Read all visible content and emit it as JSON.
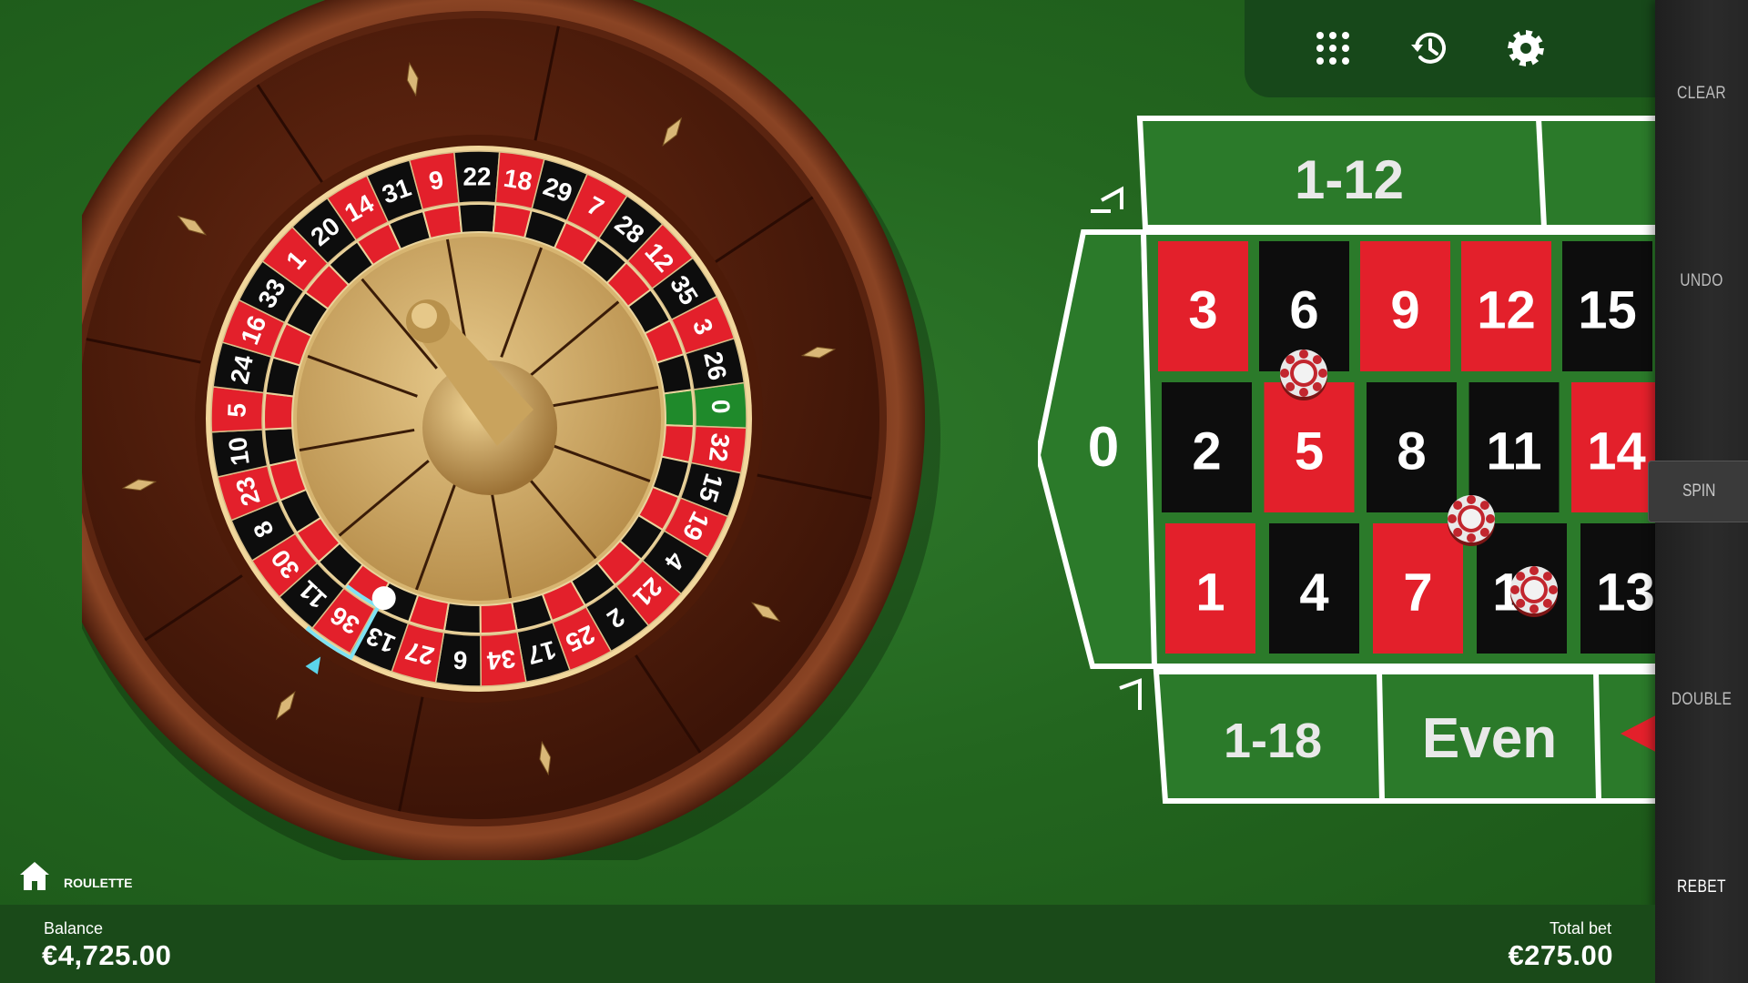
{
  "game": {
    "name": "ROULETTE"
  },
  "toolbar": {
    "icons": [
      "stats-dots-icon",
      "history-icon",
      "settings-gear-icon"
    ]
  },
  "sidebar": {
    "clear": "CLEAR",
    "undo": "UNDO",
    "spin": "SPIN",
    "double": "DOUBLE",
    "rebet": "REBET"
  },
  "balance": {
    "label": "Balance",
    "value": "€4,725.00"
  },
  "total_bet": {
    "label": "Total bet",
    "value": "€275.00"
  },
  "wheel": {
    "numbers": [
      0,
      32,
      15,
      19,
      4,
      21,
      2,
      25,
      17,
      34,
      6,
      27,
      13,
      36,
      11,
      30,
      8,
      23,
      10,
      5,
      24,
      16,
      33,
      1,
      20,
      14,
      31,
      9,
      22,
      18,
      29,
      7,
      28,
      12,
      35,
      3,
      26
    ],
    "red_numbers": [
      1,
      3,
      5,
      7,
      9,
      12,
      14,
      16,
      18,
      19,
      21,
      23,
      25,
      27,
      30,
      32,
      34,
      36
    ],
    "highlighted_number": 36
  },
  "table": {
    "zero": "0",
    "dozen": "1-12",
    "low": "1-18",
    "even": "Even",
    "rows": [
      [
        {
          "n": "3",
          "c": "red"
        },
        {
          "n": "6",
          "c": "black"
        },
        {
          "n": "9",
          "c": "red"
        },
        {
          "n": "12",
          "c": "red"
        },
        {
          "n": "15",
          "c": "black"
        }
      ],
      [
        {
          "n": "2",
          "c": "black"
        },
        {
          "n": "5",
          "c": "red"
        },
        {
          "n": "8",
          "c": "black"
        },
        {
          "n": "11",
          "c": "black"
        },
        {
          "n": "14",
          "c": "red"
        }
      ],
      [
        {
          "n": "1",
          "c": "red"
        },
        {
          "n": "4",
          "c": "black"
        },
        {
          "n": "7",
          "c": "red"
        },
        {
          "n": "10",
          "c": "black"
        },
        {
          "n": "13",
          "c": "black"
        }
      ]
    ],
    "chips_on": [
      "split 5-6",
      "corner 7-8-10-11",
      "straight 10"
    ]
  },
  "colors": {
    "felt": "#23661f",
    "red": "#e3202b",
    "black": "#0d0d0d",
    "sidebar": "#262626"
  }
}
